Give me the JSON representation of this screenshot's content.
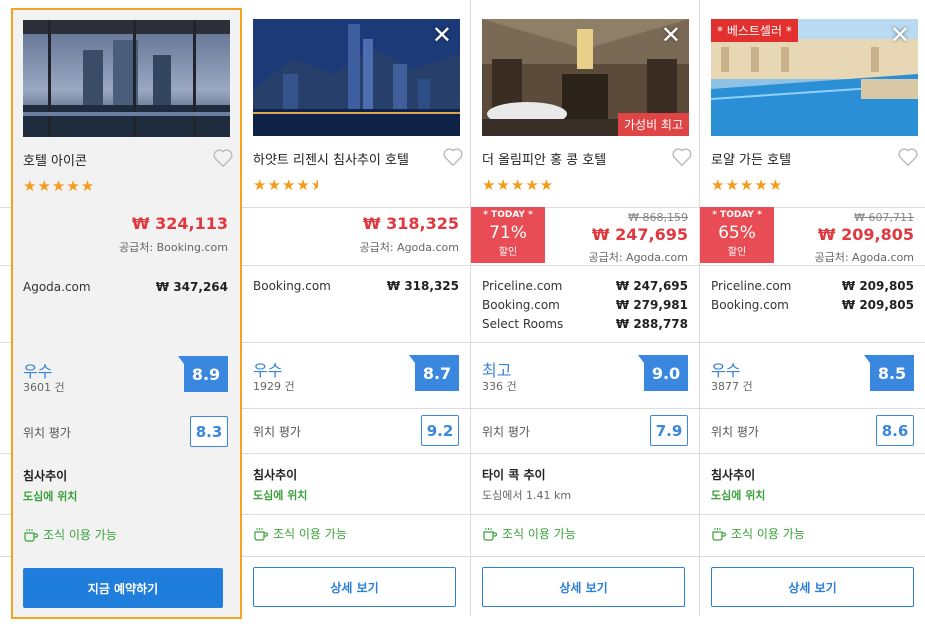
{
  "currency": "₩",
  "hotels": [
    {
      "name": "호텔 아이콘",
      "stars": "★★★★★",
      "price": "₩ 324,113",
      "supplier": "공급처: Booking.com",
      "offers": [
        {
          "site": "Agoda.com",
          "price": "₩ 347,264"
        }
      ],
      "rating_word": "우수",
      "reviews": "3601 건",
      "score": "8.9",
      "location_label": "위치 평가",
      "location_score": "8.3",
      "area": "침사추이",
      "area_sub": "도심에 위치",
      "breakfast": "조식 이용 가능",
      "button": "지금 예약하기"
    },
    {
      "name": "하얏트 리젠시 침사추이 호텔",
      "stars": "★★★★",
      "price": "₩ 318,325",
      "supplier": "공급처: Agoda.com",
      "offers": [
        {
          "site": "Booking.com",
          "price": "₩ 318,325"
        }
      ],
      "rating_word": "우수",
      "reviews": "1929 건",
      "score": "8.7",
      "location_label": "위치 평가",
      "location_score": "9.2",
      "area": "침사추이",
      "area_sub": "도심에 위치",
      "breakfast": "조식 이용 가능",
      "button": "상세 보기"
    },
    {
      "name": "더 올림피안 홍 콩 호텔",
      "stars": "★★★★★",
      "corner_tag": "가성비 최고",
      "deal": {
        "today": "* TODAY *",
        "percent": "71%",
        "label": "할인"
      },
      "old_price": "₩ 868,159",
      "price": "₩ 247,695",
      "supplier": "공급처: Agoda.com",
      "offers": [
        {
          "site": "Priceline.com",
          "price": "₩ 247,695"
        },
        {
          "site": "Booking.com",
          "price": "₩ 279,981"
        },
        {
          "site": "Select Rooms",
          "price": "₩ 288,778"
        }
      ],
      "rating_word": "최고",
      "reviews": "336 건",
      "score": "9.0",
      "location_label": "위치 평가",
      "location_score": "7.9",
      "area": "타이 콕 추이",
      "area_sub": "도심에서 1.41 km",
      "breakfast": "조식 이용 가능",
      "button": "상세 보기"
    },
    {
      "name": "로얄 가든 호텔",
      "stars": "★★★★★",
      "best_tag": "* 베스트셀러 *",
      "deal": {
        "today": "* TODAY *",
        "percent": "65%",
        "label": "할인"
      },
      "old_price": "₩ 607,711",
      "price": "₩ 209,805",
      "supplier": "공급처: Agoda.com",
      "offers": [
        {
          "site": "Priceline.com",
          "price": "₩ 209,805"
        },
        {
          "site": "Booking.com",
          "price": "₩ 209,805"
        }
      ],
      "rating_word": "우수",
      "reviews": "3877 건",
      "score": "8.5",
      "location_label": "위치 평가",
      "location_score": "8.6",
      "area": "침사추이",
      "area_sub": "도심에 위치",
      "breakfast": "조식 이용 가능",
      "button": "상세 보기"
    }
  ],
  "colors": {
    "accent": "#1f7ddb",
    "price": "#e0383e",
    "deal": "#e84d55",
    "highlight_border": "#f4a31f",
    "green": "#3aa13a"
  }
}
